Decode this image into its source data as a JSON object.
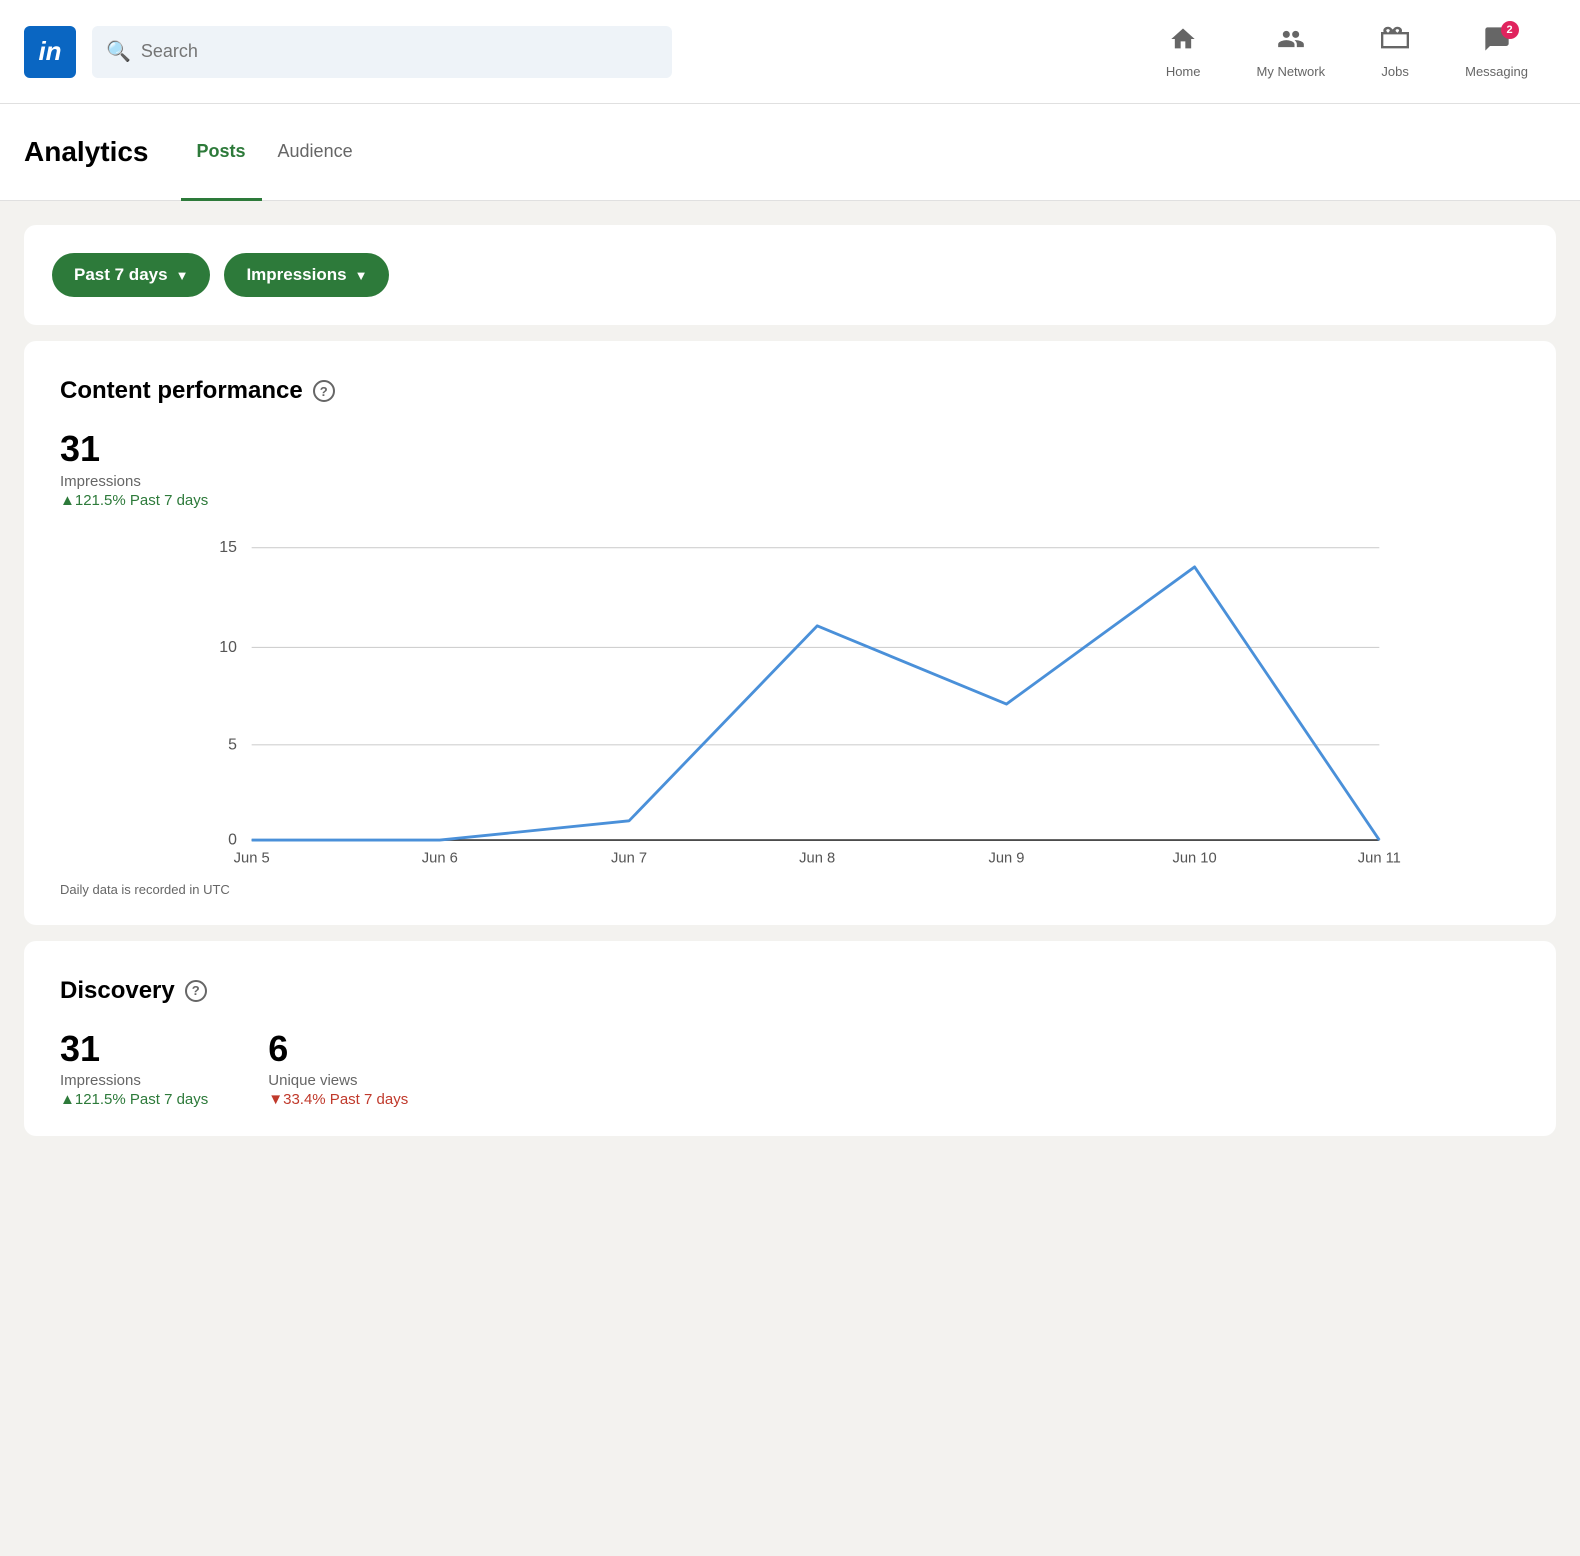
{
  "header": {
    "logo": "in",
    "search_placeholder": "Search",
    "nav": [
      {
        "id": "home",
        "label": "Home",
        "icon": "🏠",
        "badge": 0
      },
      {
        "id": "my-network",
        "label": "My Network",
        "icon": "👥",
        "badge": 0
      },
      {
        "id": "jobs",
        "label": "Jobs",
        "icon": "💼",
        "badge": 0
      },
      {
        "id": "messaging",
        "label": "Messaging",
        "icon": "💬",
        "badge": 2
      }
    ]
  },
  "sub_nav": {
    "title": "Analytics",
    "tabs": [
      {
        "id": "posts",
        "label": "Posts",
        "active": true
      },
      {
        "id": "audience",
        "label": "Audience",
        "active": false
      }
    ]
  },
  "filters": {
    "time_range": "Past 7 days",
    "metric": "Impressions"
  },
  "content_performance": {
    "section_title": "Content performance",
    "metric_value": "31",
    "metric_label": "Impressions",
    "metric_change": "▲121.5% Past 7 days",
    "chart": {
      "x_labels": [
        "Jun 5",
        "Jun 6",
        "Jun 7",
        "Jun 8",
        "Jun 9",
        "Jun 10",
        "Jun 11"
      ],
      "y_labels": [
        "15",
        "10",
        "5",
        "0"
      ],
      "data_points": [
        0,
        0,
        1,
        11,
        7,
        14,
        0
      ],
      "footer": "Daily data is recorded in UTC"
    }
  },
  "discovery": {
    "section_title": "Discovery",
    "metrics": [
      {
        "value": "31",
        "label": "Impressions",
        "change": "▲121.5% Past 7 days",
        "direction": "positive"
      },
      {
        "value": "6",
        "label": "Unique views",
        "change": "▼33.4% Past 7 days",
        "direction": "negative"
      }
    ]
  }
}
